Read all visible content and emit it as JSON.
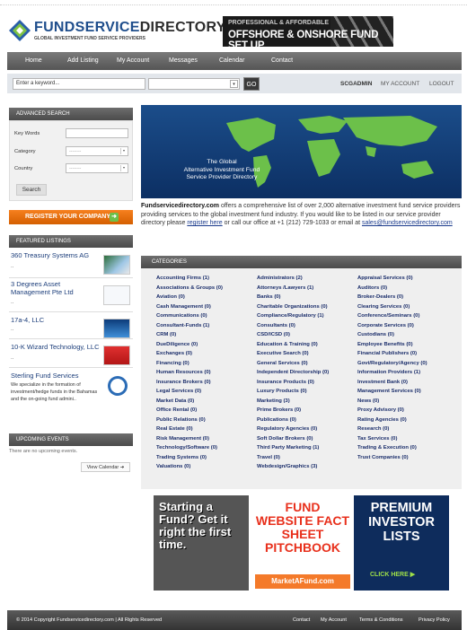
{
  "header": {
    "logo_name_part1": "FUNDSERVICE",
    "logo_name_part2": "DIRECTORY.COM",
    "logo_tagline": "GLOBAL INVESTMENT FUND SERVICE PROVIDERS",
    "banner_line1": "PROFESSIONAL & AFFORDABLE",
    "banner_line2": "OFFSHORE & ONSHORE FUND SET UP"
  },
  "nav": {
    "items": [
      "Home",
      "Add Listing",
      "My Account",
      "Messages",
      "Calendar",
      "Contact"
    ]
  },
  "search": {
    "keyword_placeholder": "Enter a keyword...",
    "go_label": "GO",
    "user_label": "SCGADMIN",
    "my_account": "MY ACCOUNT",
    "logout": "LOGOUT"
  },
  "advanced_search": {
    "title": "ADVANCED SEARCH",
    "keywords_label": "Key Words",
    "category_label": "Category",
    "category_value": "--------",
    "country_label": "Country",
    "country_value": "--------",
    "search_button": "Search"
  },
  "register_label": "REGISTER YOUR COMPANY",
  "featured": {
    "title": "FEATURED LISTINGS",
    "items": [
      {
        "name": "360 Treasury Systems AG",
        "dots": ".."
      },
      {
        "name": "3 Degrees Asset Management Pte Ltd",
        "dots": ".."
      },
      {
        "name": "17a-4, LLC",
        "dots": ".."
      },
      {
        "name": "10-K Wizard Technology, LLC",
        "dots": ".."
      },
      {
        "name": "Sterling Fund Services",
        "desc": "We specialize in the formation of investment/hedge funds in the Bahamas and the on-going fund admini.."
      }
    ]
  },
  "events": {
    "title": "UPCOMING EVENTS",
    "empty_text": "There are no upcoming events.",
    "view_calendar": "View Calendar"
  },
  "map": {
    "caption_line1": "The Global",
    "caption_line2": "Alternative Investment Fund",
    "caption_line3": "Service Provider Directory"
  },
  "intro": {
    "site": "Fundservicedirectory.com",
    "text1": " offers a comprehensive list of over 2,000 alternative investment fund service providers providing services to the global investment fund industry. If you would like to be listed in our service provider directory please ",
    "link1": "register here",
    "text2": " or call our office at +1 (212) 729-1033 or email at ",
    "email": "sales@fundservicedirectory.com"
  },
  "categories": {
    "title": "CATEGORIES",
    "col1": [
      "Accounting Firms (1)",
      "Associations & Groups (0)",
      "Aviation (0)",
      "Cash Management (0)",
      "Communications (0)",
      "Consultant-Funds (1)",
      "CRM (0)",
      "DueDiligence (0)",
      "Exchanges (0)",
      "Financing (0)",
      "Human Resources (0)",
      "Insurance Brokers (0)",
      "Legal Services (0)",
      "Market Data (0)",
      "Office Rental (0)",
      "Public Relations (0)",
      "Real Estate (0)",
      "Risk Management (0)",
      "Technology/Software (0)",
      "Trading Systems (0)",
      "Valuations (0)"
    ],
    "col2": [
      "Administrators (2)",
      "Attorneys /Lawyers (1)",
      "Banks (0)",
      "Charitable Organizations (0)",
      "Compliance/Regulatory (1)",
      "Consultants (0)",
      "CSD/ICSD (0)",
      "Education & Training (0)",
      "Executive Search (0)",
      "General Services (0)",
      "Independent Directorship (0)",
      "Insurance Products (0)",
      "Luxury Products (0)",
      "Marketing (3)",
      "Prime Brokers (0)",
      "Publications (0)",
      "Regulatory Agencies (0)",
      "Soft Dollar Brokers (0)",
      "Third Party Marketing (1)",
      "Travel (0)",
      "Webdesign/Graphics (3)"
    ],
    "col3": [
      "Appraisal Services (0)",
      "Auditors (0)",
      "Broker-Dealers (0)",
      "Clearing Services (0)",
      "Conference/Seminars (0)",
      "Corporate Services (0)",
      "Custodians (0)",
      "Employee Benefits (0)",
      "Financial Publishers (0)",
      "Govt/Regulatory/Agency (0)",
      "Information Providers (1)",
      "Investment Bank (0)",
      "Management Services (0)",
      "News (0)",
      "Proxy Advisory (0)",
      "Rating Agencies (0)",
      "Research (0)",
      "Tax Services (0)",
      "Trading & Execution (0)",
      "Trust Companies (0)"
    ]
  },
  "ads": {
    "ad1": "Starting a Fund? Get it right the first time.",
    "ad2": "FUND WEBSITE FACT SHEET PITCHBOOK",
    "ad2_url": "MarketAFund.com",
    "ad3": "PREMIUM INVESTOR LISTS",
    "ad3_cta": "CLICK HERE"
  },
  "footer": {
    "copyright": "© 2014 Copyright Fundservicedirectory.com | All Rights Reserved",
    "links": [
      "Contact",
      "My Account",
      "Terms & Conditions",
      "Privacy Policy"
    ]
  },
  "colors": {
    "nav_bg": "#5f5f5f",
    "accent_orange": "#e56b0a",
    "link_blue": "#1b2e6b"
  }
}
